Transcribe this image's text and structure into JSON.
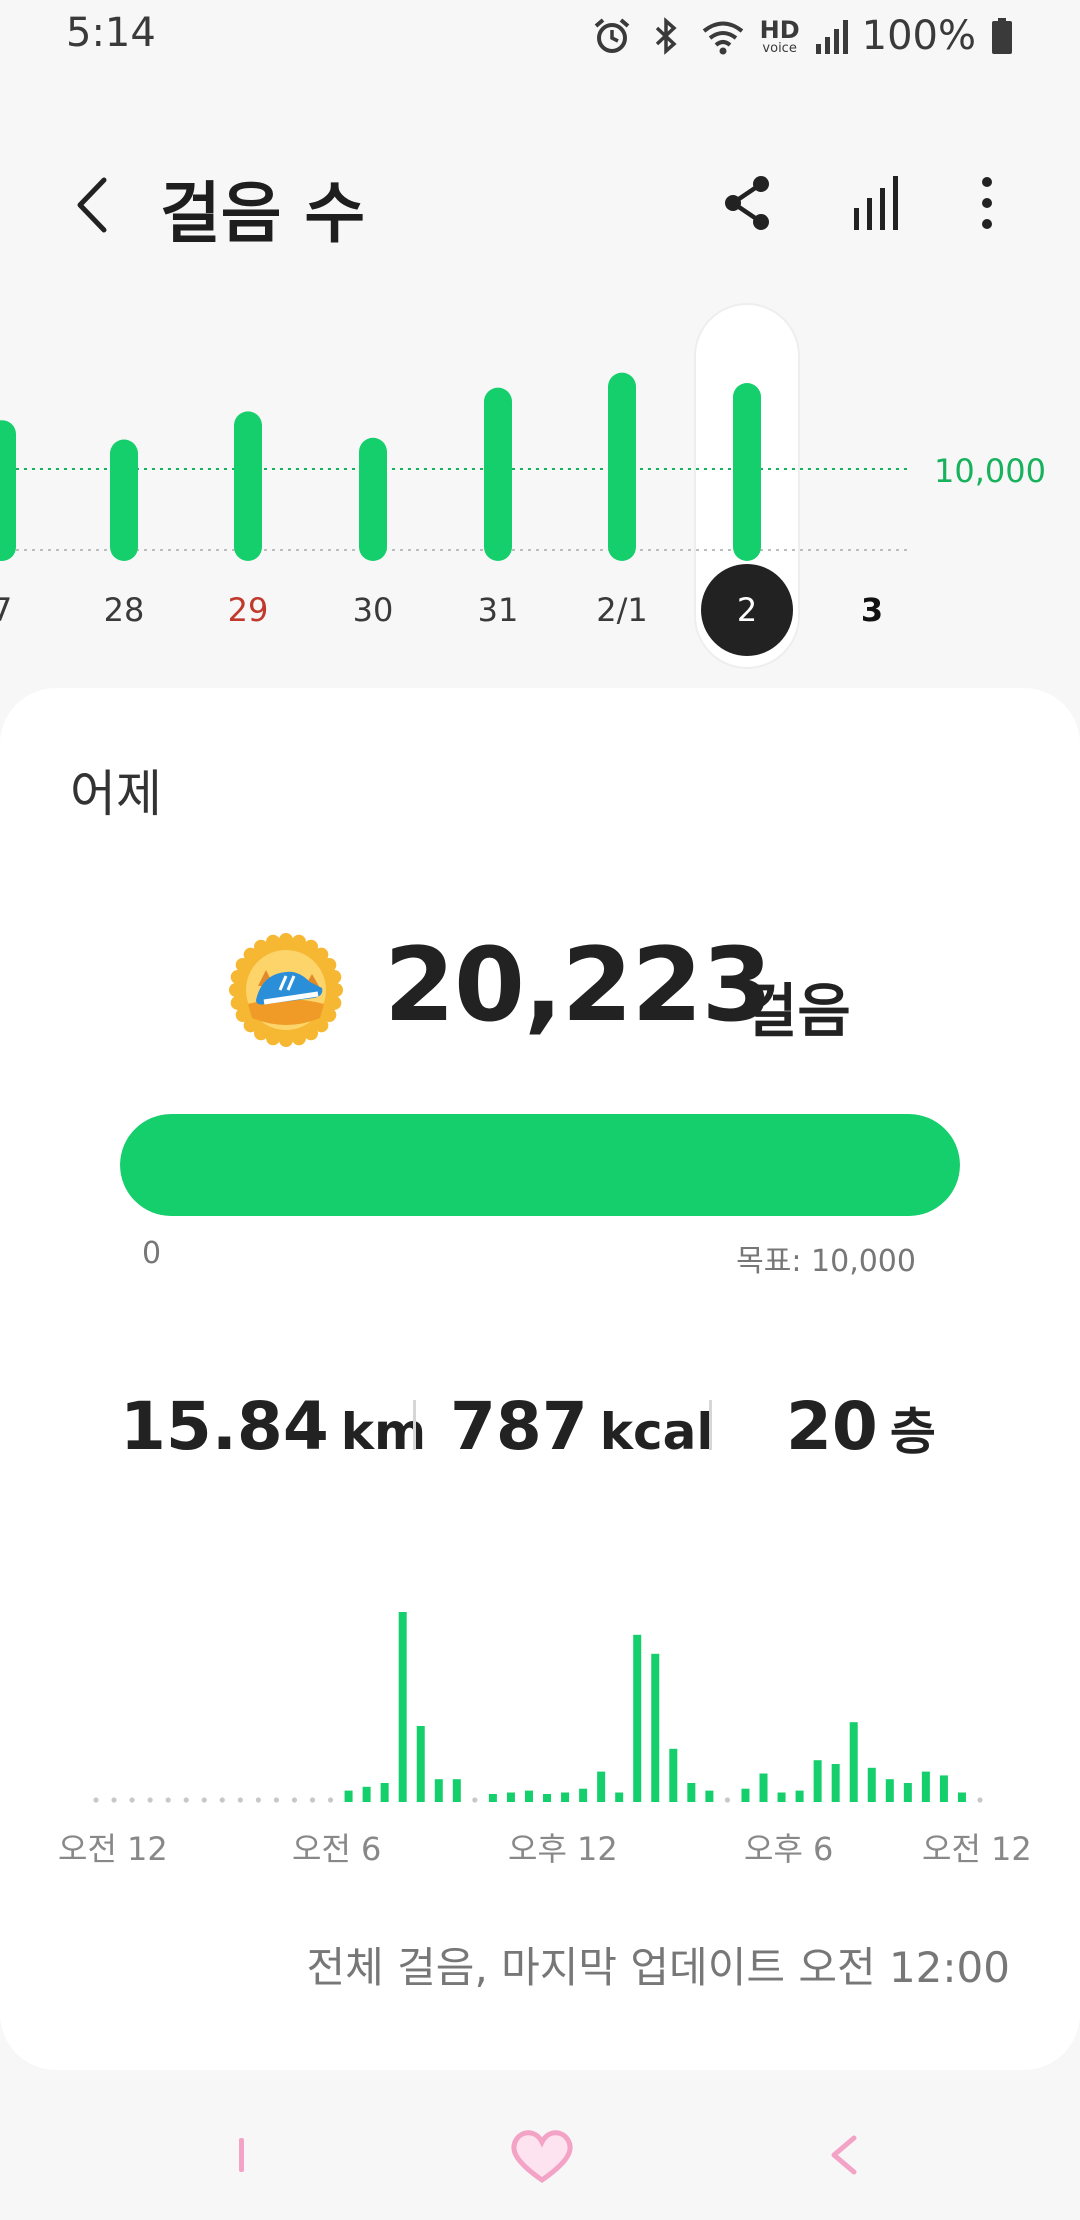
{
  "status_bar": {
    "time": "5:14",
    "battery": "100%",
    "hd_label": "HD",
    "voice_label": "voice",
    "icons": [
      "alarm-icon",
      "bluetooth-icon",
      "wifi-icon",
      "hd-voice-icon",
      "signal-icon",
      "battery-icon"
    ]
  },
  "header": {
    "title": "걸음 수",
    "back_icon": "back-icon",
    "share_icon": "share-icon",
    "trends_icon": "bar-chart-icon",
    "more_icon": "more-vertical-icon"
  },
  "week_chart": {
    "goal_label": "10,000",
    "days": [
      {
        "label": "7",
        "steps": 16000,
        "color": "#3a3a3a"
      },
      {
        "label": "28",
        "steps": 13800,
        "color": "#3a3a3a"
      },
      {
        "label": "29",
        "steps": 17000,
        "color": "#c0392b"
      },
      {
        "label": "30",
        "steps": 14000,
        "color": "#3a3a3a"
      },
      {
        "label": "31",
        "steps": 19700,
        "color": "#3a3a3a"
      },
      {
        "label": "2/1",
        "steps": 21400,
        "color": "#3a3a3a"
      },
      {
        "label": "2",
        "steps": 20223,
        "color": "#ffffff",
        "selected": true
      },
      {
        "label": "3",
        "steps": null,
        "color": "#111111",
        "bold": true
      }
    ]
  },
  "summary": {
    "day_label": "어제",
    "steps": "20,223",
    "steps_unit": "걸음",
    "progress_ratio": 1.0,
    "progress_min": "0",
    "progress_goal": "목표: 10,000",
    "distance_value": "15.84",
    "distance_unit": "km",
    "calories_value": "787",
    "calories_unit": "kcal",
    "floors_value": "20",
    "floors_unit": "층"
  },
  "day_chart": {
    "time_labels": [
      "오전 12",
      "오전 6",
      "오후 12",
      "오후 6",
      "오전 12"
    ],
    "bars": [
      0,
      0,
      0,
      0,
      0,
      0,
      0,
      0,
      0,
      0,
      0,
      0,
      0,
      0,
      6,
      8,
      10,
      100,
      40,
      12,
      12,
      0,
      4,
      5,
      6,
      4,
      5,
      7,
      16,
      5,
      88,
      78,
      28,
      10,
      6,
      0,
      7,
      15,
      5,
      6,
      22,
      20,
      42,
      18,
      12,
      10,
      16,
      14,
      5,
      0
    ],
    "footer_note": "전체 걸음, 마지막 업데이트 오전 12:00"
  },
  "colors": {
    "accent": "#14cf6b",
    "goal_line": "#18b25d",
    "selected_bg": "#222222",
    "nav_pink": "#f3a3c6"
  },
  "nav_bar": {
    "recent_icon": "recent-apps-icon",
    "home_icon": "home-heart-icon",
    "back_icon": "nav-back-icon"
  }
}
